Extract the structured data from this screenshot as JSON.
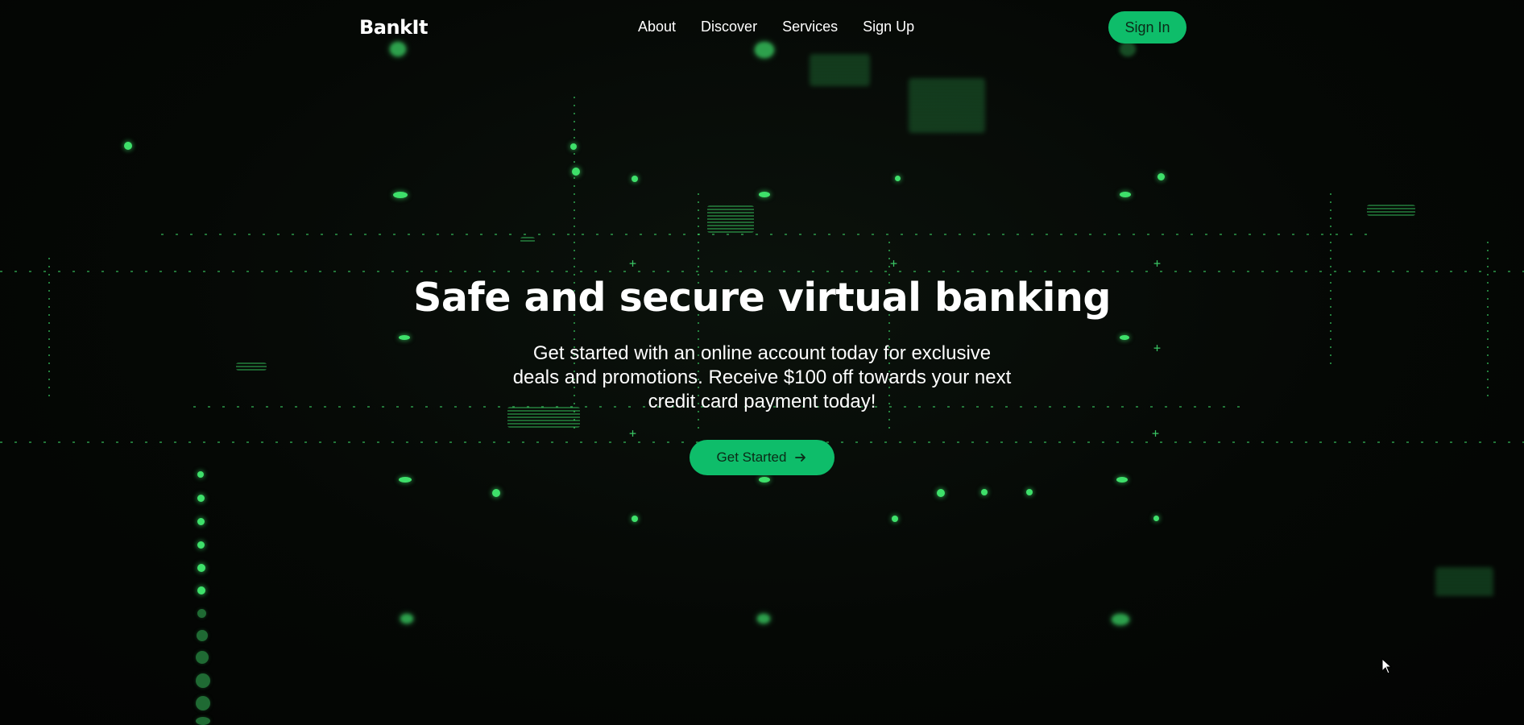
{
  "brand": {
    "name": "BankIt"
  },
  "nav": {
    "links": [
      "About",
      "Discover",
      "Services",
      "Sign Up"
    ],
    "signin_label": "Sign In"
  },
  "hero": {
    "title": "Safe and secure virtual banking",
    "subtitle": "Get started with an online account today for exclusive deals and promotions. Receive $100 off towards your next credit card payment today!",
    "cta_label": "Get Started",
    "cta_icon": "arrow-right-icon"
  },
  "colors": {
    "accent": "#0ebd6a",
    "background": "#050705",
    "text": "#ffffff",
    "matrix_green": "#3ee06a"
  }
}
